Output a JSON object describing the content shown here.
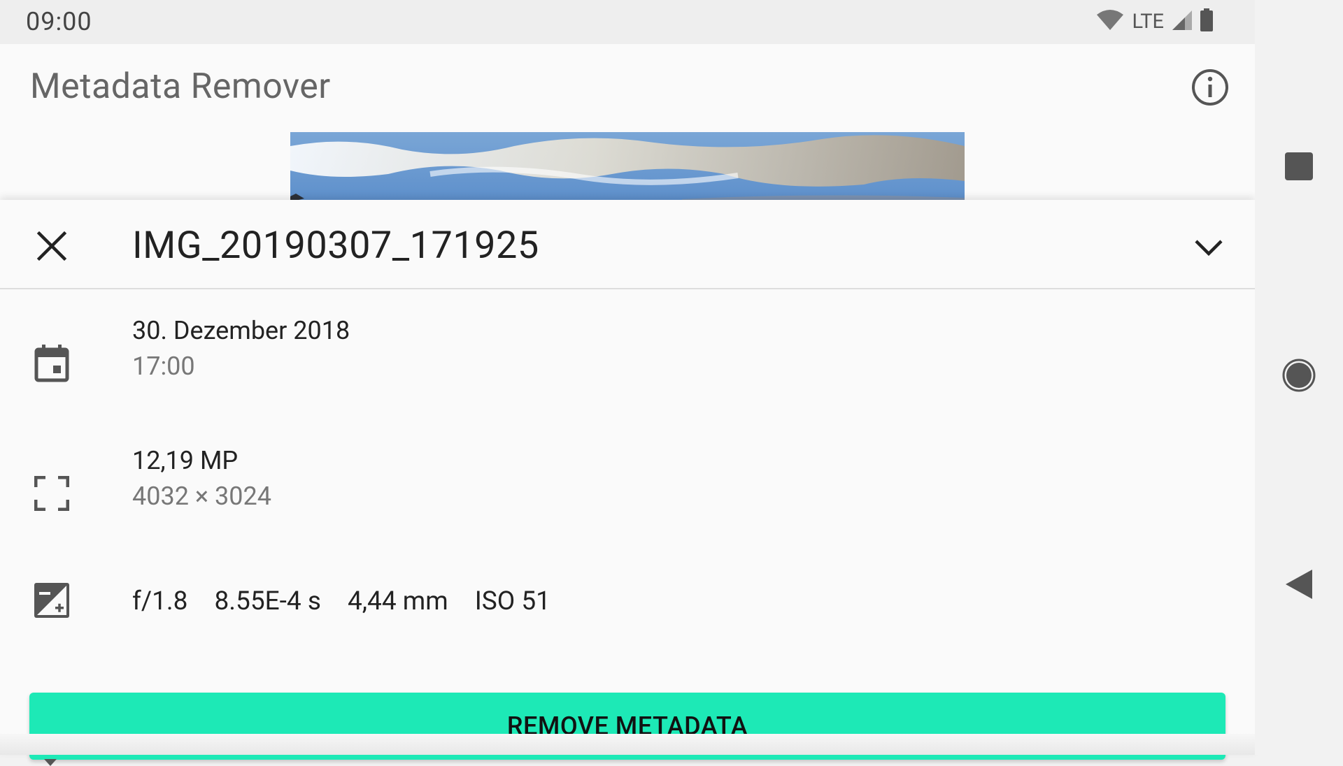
{
  "status_bar": {
    "time": "09:00",
    "network": "LTE",
    "icons": [
      "wifi-icon",
      "signal-icon",
      "battery-icon"
    ]
  },
  "toolbar": {
    "title": "Metadata Remover",
    "info_icon": "info-icon"
  },
  "sheet": {
    "file_name": "IMG_20190307_171925",
    "close_icon": "close-icon",
    "expand_icon": "chevron-down-icon",
    "date": {
      "icon": "calendar-icon",
      "primary": "30. Dezember 2018",
      "secondary": "17:00"
    },
    "size": {
      "icon": "crop-free-icon",
      "primary": "12,19 MP",
      "secondary": "4032 × 3024"
    },
    "exposure": {
      "icon": "exposure-icon",
      "aperture": "f/1.8",
      "shutter": "8.55E-4 s",
      "focal_length": "4,44 mm",
      "iso": "ISO 51"
    }
  },
  "actions": {
    "remove_label": "REMOVE METADATA"
  },
  "nav_bar": {
    "items": [
      "recents-button",
      "home-button",
      "back-button"
    ]
  },
  "colors": {
    "accent": "#1de9b6",
    "background": "#fafafa",
    "status_bar": "#eeeeee"
  }
}
